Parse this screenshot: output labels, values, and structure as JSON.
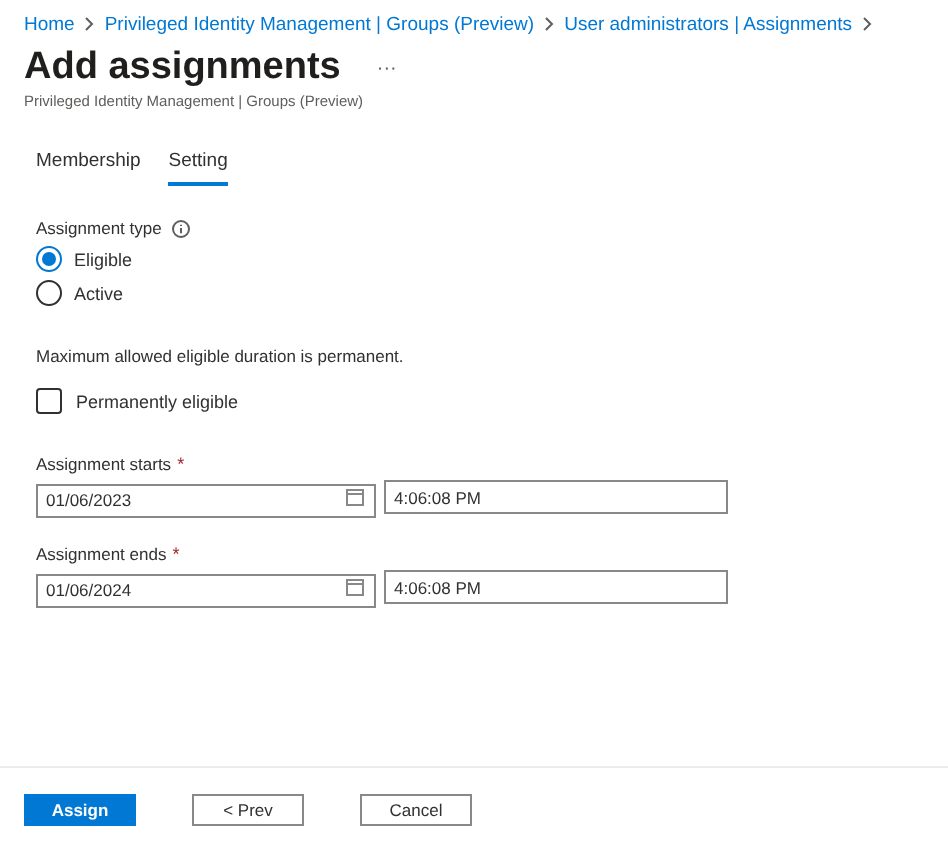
{
  "breadcrumb": [
    {
      "label": "Home"
    },
    {
      "label": "Privileged Identity Management | Groups (Preview)"
    },
    {
      "label": "User administrators | Assignments"
    }
  ],
  "title": "Add assignments",
  "more": "···",
  "subtitle": "Privileged Identity Management | Groups (Preview)",
  "tabs": [
    {
      "label": "Membership",
      "selected": false
    },
    {
      "label": "Setting",
      "selected": true
    }
  ],
  "assignment_type": {
    "label": "Assignment type",
    "options": [
      {
        "label": "Eligible",
        "selected": true
      },
      {
        "label": "Active",
        "selected": false
      }
    ]
  },
  "info": "Maximum allowed eligible duration is permanent.",
  "permanent": {
    "label": "Permanently eligible",
    "checked": false
  },
  "dates": [
    {
      "label": "Assignment starts",
      "required": "*",
      "date": "01/06/2023",
      "time": "4:06:08 PM"
    },
    {
      "label": "Assignment ends",
      "required": "*",
      "date": "01/06/2024",
      "time": "4:06:08 PM"
    }
  ],
  "buttons": [
    {
      "label": "Assign",
      "kind": "primary"
    },
    {
      "label": "< Prev",
      "kind": "secondary"
    },
    {
      "label": "Cancel",
      "kind": "secondary"
    }
  ]
}
